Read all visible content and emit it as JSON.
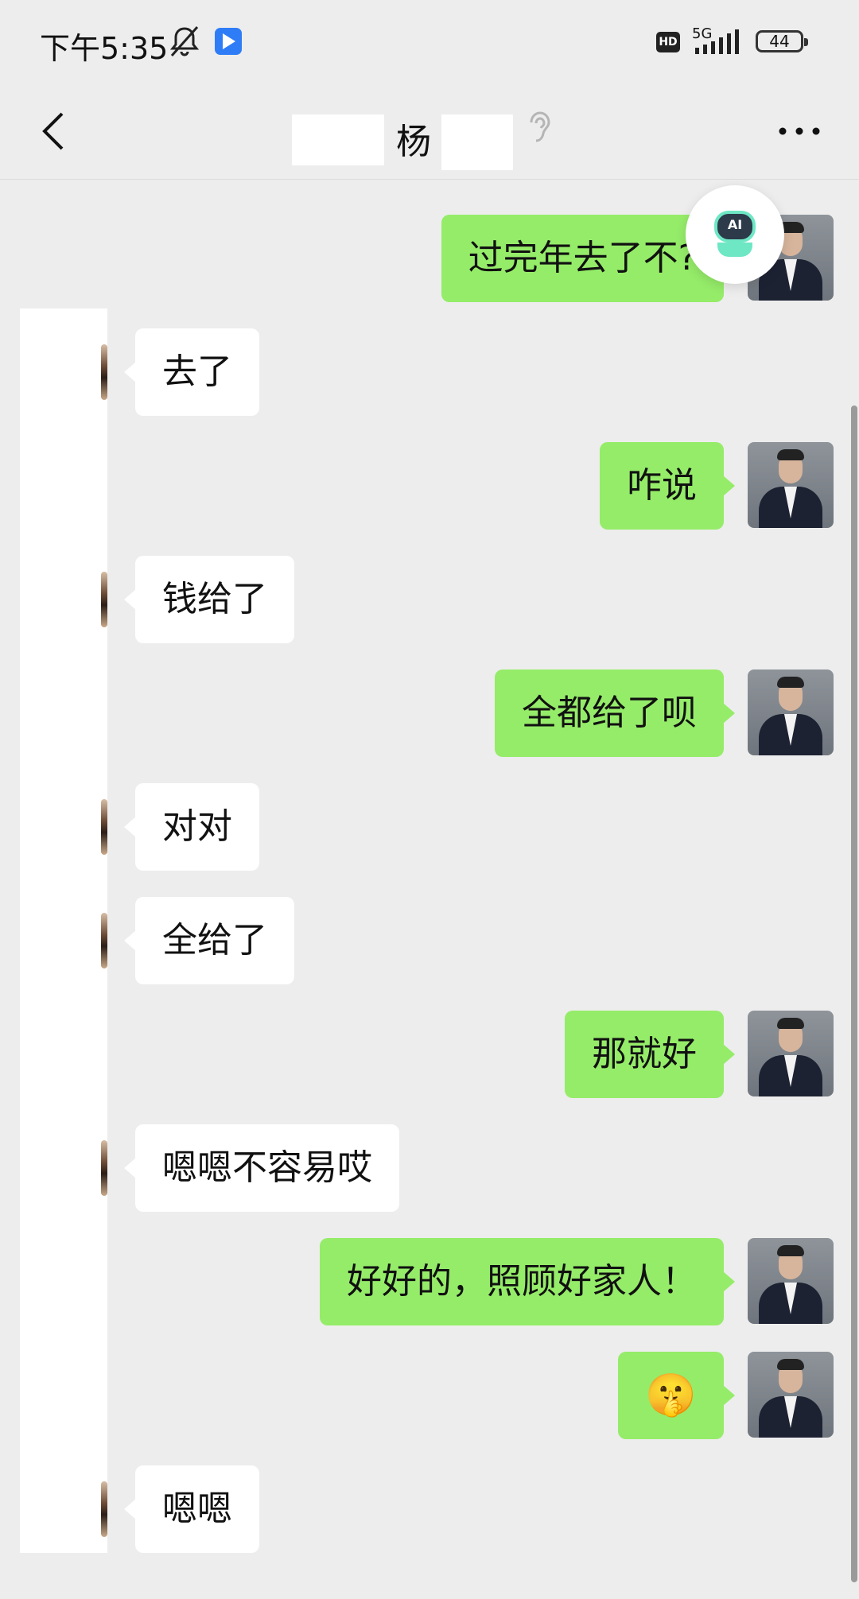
{
  "status_bar": {
    "time": "下午5:35",
    "network": "5G",
    "hd_label": "HD",
    "battery": "44",
    "icons": [
      "mute-icon",
      "app-notification-icon",
      "hd-icon",
      "signal-icon",
      "battery-icon"
    ]
  },
  "title_bar": {
    "back_icon": "chevron-left-icon",
    "chat_title": "杨",
    "ear_icon": "ear-icon",
    "more_icon": "more-dots-icon"
  },
  "floating_button": {
    "label": "AI",
    "icon": "ai-assistant-icon"
  },
  "colors": {
    "background": "#ededed",
    "my_bubble": "#95ec69",
    "their_bubble": "#ffffff",
    "ai_accent": "#6ee7c4"
  },
  "messages": [
    {
      "sender": "me",
      "text": "过完年去了不?"
    },
    {
      "sender": "them",
      "text": "去了"
    },
    {
      "sender": "me",
      "text": "咋说"
    },
    {
      "sender": "them",
      "text": "钱给了"
    },
    {
      "sender": "me",
      "text": "全都给了呗"
    },
    {
      "sender": "them",
      "text": "对对"
    },
    {
      "sender": "them",
      "text": "全给了"
    },
    {
      "sender": "me",
      "text": "那就好"
    },
    {
      "sender": "them",
      "text": "嗯嗯不容易哎"
    },
    {
      "sender": "me",
      "text": "好好的，照顾好家人！"
    },
    {
      "sender": "me",
      "text": "🤫"
    },
    {
      "sender": "them",
      "text": "嗯嗯"
    }
  ]
}
